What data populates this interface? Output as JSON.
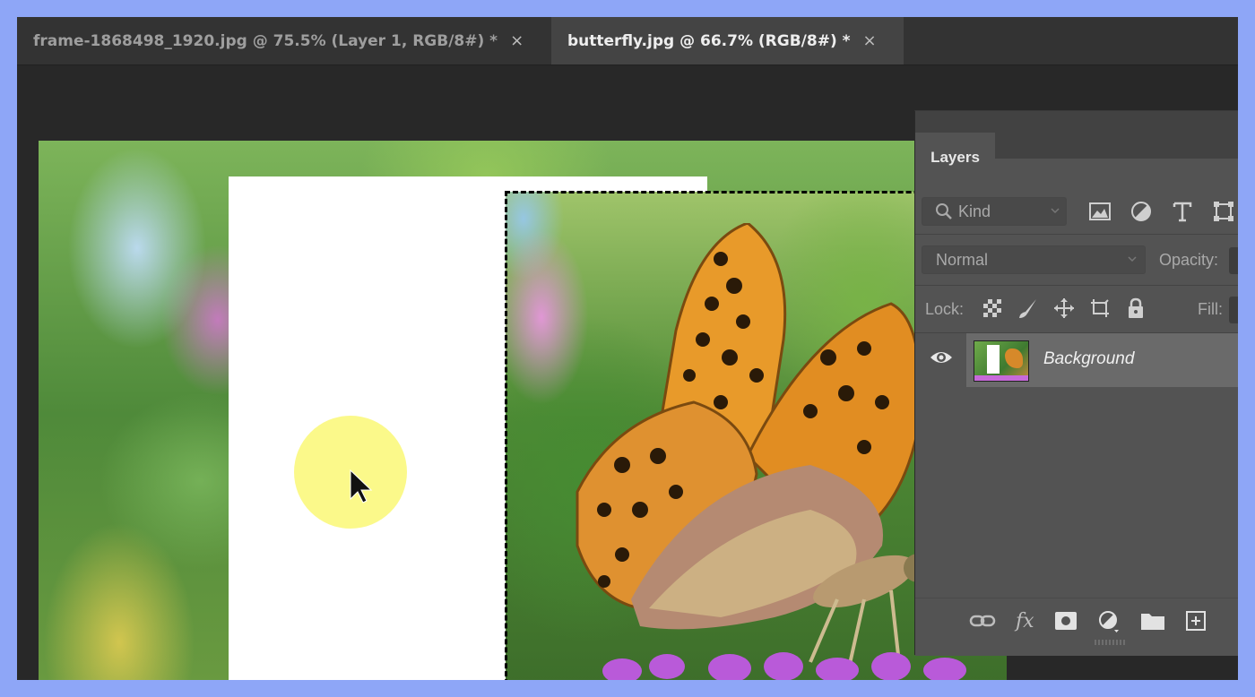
{
  "tabs": [
    {
      "title": "frame-1868498_1920.jpg @ 75.5% (Layer 1, RGB/8#) *",
      "close": "×"
    },
    {
      "title": "butterfly.jpg @ 66.7% (RGB/8#) *",
      "close": "×"
    }
  ],
  "active_tab": 1,
  "layers_panel": {
    "tab_label": "Layers",
    "filter": {
      "placeholder": "Kind",
      "icon": "search-icon"
    },
    "blend_mode": "Normal",
    "opacity_label": "Opacity:",
    "lock_label": "Lock:",
    "fill_label": "Fill:",
    "layers": [
      {
        "name": "Background",
        "visible": true
      }
    ]
  },
  "colors": {
    "app_bg": "#282828",
    "tab_active": "#444444",
    "panel_bg": "#535353",
    "frame_border": "#8ea6f7",
    "cursor_highlight": "#fbf98a"
  }
}
